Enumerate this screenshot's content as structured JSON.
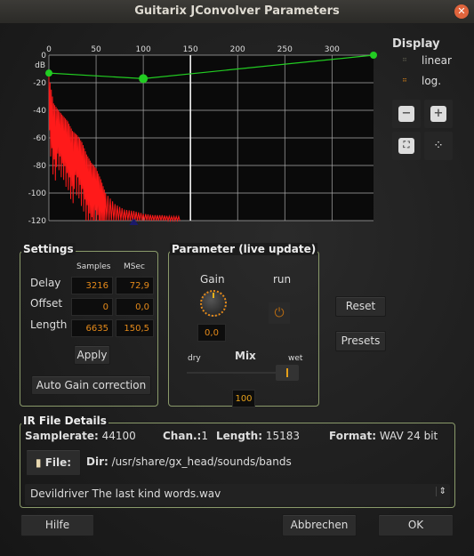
{
  "window": {
    "title": "Guitarix JConvolver Parameters",
    "close_icon": "close-icon"
  },
  "display": {
    "title": "Display",
    "linear": "linear",
    "log": "log.",
    "selected": "log."
  },
  "chart_data": {
    "type": "line",
    "ylabel": "dB",
    "xlim": [
      0,
      344
    ],
    "ylim": [
      -120,
      0
    ],
    "x_ticks": [
      "0",
      "50",
      "100",
      "150",
      "200",
      "250",
      "300"
    ],
    "y_ticks": [
      "0",
      "-20",
      "-40",
      "-60",
      "-80",
      "-100",
      "-120"
    ],
    "grid": true,
    "marker_x": 150,
    "series": [
      {
        "role": "gain-envelope",
        "color": "#22cc22",
        "x": [
          0,
          100,
          344
        ],
        "y": [
          -13,
          -17,
          0
        ]
      },
      {
        "role": "impulse-response",
        "color": "#ff1a1a",
        "x": [
          0,
          5,
          10,
          15,
          20,
          25,
          30,
          35,
          40,
          45,
          50,
          55,
          60,
          70,
          80,
          90,
          100,
          110,
          120,
          130,
          140
        ],
        "y": [
          -15,
          -35,
          -40,
          -44,
          -48,
          -55,
          -58,
          -63,
          -72,
          -78,
          -82,
          -90,
          -100,
          -108,
          -112,
          -113,
          -115,
          -116,
          -116,
          -117,
          -117
        ]
      }
    ]
  },
  "settings": {
    "title": "Settings",
    "col_samples": "Samples",
    "col_msec": "MSec",
    "rows": [
      {
        "label": "Delay",
        "samples": "3216",
        "msec": "72,9"
      },
      {
        "label": "Offset",
        "samples": "0",
        "msec": "0,0"
      },
      {
        "label": "Length",
        "samples": "6635",
        "msec": "150,5"
      }
    ],
    "apply": "Apply",
    "auto_gain": "Auto Gain correction"
  },
  "parameter": {
    "title": "Parameter (live update)",
    "gain_label": "Gain",
    "gain_value": "0,0",
    "run_label": "run",
    "mix_label": "Mix",
    "dry": "dry",
    "wet": "wet",
    "mix_value": "100",
    "mix_fraction": 1.0
  },
  "reset": "Reset",
  "presets": "Presets",
  "ir": {
    "title": "IR File Details",
    "samplerate_label": "Samplerate:",
    "samplerate": "44100",
    "chan_label": "Chan.:",
    "chan": "1",
    "length_label": "Length:",
    "length": "15183",
    "format_label": "Format:",
    "format": "WAV 24 bit",
    "file_button": "File:",
    "dir_label": "Dir:",
    "dir": "/usr/share/gx_head/sounds/bands",
    "selected_file": "Devildriver The last kind words.wav"
  },
  "footer": {
    "help": "Hilfe",
    "cancel": "Abbrechen",
    "ok": "OK"
  },
  "colors": {
    "accent": "#e58a1a",
    "frame": "#8a9a6a",
    "envelope": "#22cc22",
    "ir": "#ff1a1a"
  }
}
